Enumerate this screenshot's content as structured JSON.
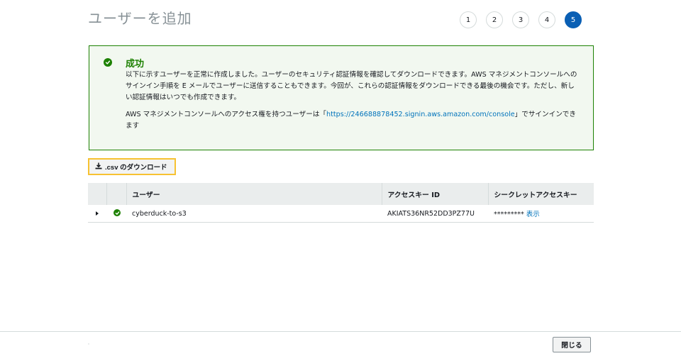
{
  "page": {
    "title": "ユーザーを追加"
  },
  "steps": [
    "1",
    "2",
    "3",
    "4",
    "5"
  ],
  "active_step": "5",
  "success": {
    "title": "成功",
    "body1": "以下に示すユーザーを正常に作成しました。ユーザーのセキュリティ認証情報を確認してダウンロードできます。AWS マネジメントコンソールへのサインイン手順を E メールでユーザーに送信することもできます。今回が、これらの認証情報をダウンロードできる最後の機会です。ただし、新しい認証情報はいつでも作成できます。",
    "body2_prefix": "AWS マネジメントコンソールへのアクセス権を持つユーザーは「",
    "console_url": "https://246688878452.signin.aws.amazon.com/console",
    "body2_suffix": "」でサインインできます"
  },
  "csv_button": {
    "label": ".csv のダウンロード",
    "icon": "download-icon"
  },
  "table": {
    "headers": {
      "user": "ユーザー",
      "access_key": "アクセスキー ID",
      "secret_key": "シークレットアクセスキー"
    },
    "rows": [
      {
        "user": "cyberduck-to-s3",
        "access_key": "AKIATS36NR52DD3PZ77U",
        "secret_masked": "*********",
        "show_label": "表示"
      }
    ]
  },
  "footer": {
    "close_label": "閉じる"
  },
  "colors": {
    "success": "#1d8102",
    "accent": "#0a5fb4",
    "link": "#0073bb",
    "highlight": "#f7c232"
  }
}
